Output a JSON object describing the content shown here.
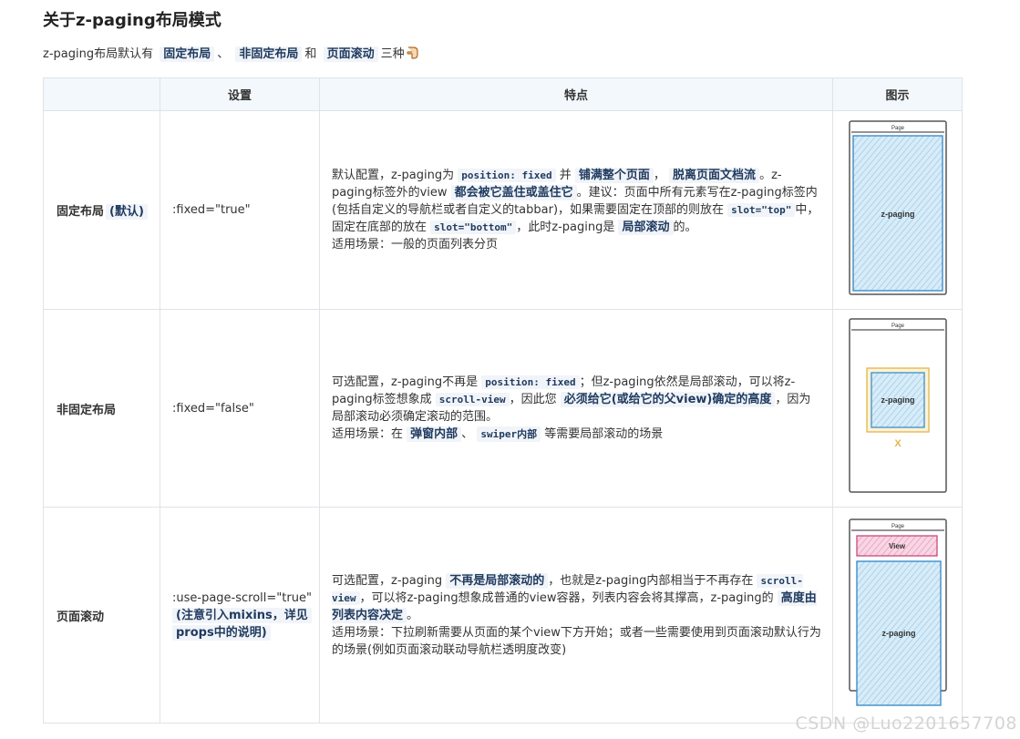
{
  "title": "关于z-paging布局模式",
  "intro": {
    "prefix": "z-paging布局默认有",
    "mode1": "固定布局",
    "sep1": "、",
    "mode2": "非固定布局",
    "sep2": "和",
    "mode3": "页面滚动",
    "suffix": "三种",
    "icon": "pointing-hand-icon"
  },
  "table": {
    "headers": [
      "",
      "设置",
      "特点",
      "图示"
    ],
    "rows": [
      {
        "name": "固定布局",
        "name_tag": "(默认)",
        "setting": ":fixed=\"true\"",
        "feature": {
          "t1": "默认配置，z-paging为",
          "c1": "position: fixed",
          "t2": "并",
          "e1": "铺满整个页面",
          "t3": "，",
          "e2": "脱离页面文档流",
          "t4": "。z-paging标签外的view",
          "e3": "都会被它盖住或盖住它",
          "t5": "。建议：页面中所有元素写在z-paging标签内(包括自定义的导航栏或者自定义的tabbar)，如果需要固定在顶部的则放在",
          "c2": "slot=\"top\"",
          "t6": "中，固定在底部的放在",
          "c3": "slot=\"bottom\"",
          "t7": "，此时z-paging是",
          "e4": "局部滚动",
          "t8": "的。",
          "scene": "适用场景：一般的页面列表分页"
        },
        "diagram": {
          "page": "Page",
          "content": "z-paging"
        }
      },
      {
        "name": "非固定布局",
        "setting": ":fixed=\"false\"",
        "feature": {
          "t1": "可选配置，z-paging不再是",
          "c1": "position: fixed",
          "t2": "；但z-paging依然是局部滚动，可以将z-paging标签想象成",
          "c2": "scroll-view",
          "t3": "，因此您",
          "e1": "必须给它(或给它的父view)确定的高度",
          "t4": "，因为局部滚动必须确定滚动的范围。",
          "scene_prefix": "适用场景：在",
          "s1": "弹窗内部",
          "scene_sep": "、",
          "s2": "swiper内部",
          "scene_suffix": "等需要局部滚动的场景"
        },
        "diagram": {
          "page": "Page",
          "content": "z-paging",
          "mark": "X"
        }
      },
      {
        "name": "页面滚动",
        "setting": ":use-page-scroll=\"true\"",
        "setting_note_1": "(注意引入mixins，详见",
        "setting_note_2": "props中的说明)",
        "feature": {
          "t1": "可选配置，z-paging",
          "e1": "不再是局部滚动的",
          "t2": "，也就是z-paging内部相当于不再存在",
          "c1": "scroll-view",
          "t3": "，可以将z-paging想象成普通的view容器，列表内容会将其撑高，z-paging的",
          "e2": "高度由列表内容决定",
          "t4": "。",
          "scene": "适用场景：下拉刷新需要从页面的某个view下方开始；或者一些需要使用到页面滚动默认行为的场景(例如页面滚动联动导航栏透明度改变)"
        },
        "diagram": {
          "page": "Page",
          "view": "View",
          "content": "z-paging"
        }
      }
    ]
  },
  "watermark": "CSDN @Luo2201657708",
  "colors": {
    "accent_text": "#1f3a5f",
    "header_bg": "#f3f8fc",
    "diagram_blue": "#c8e3f5",
    "diagram_pink": "#f4c4d8"
  }
}
